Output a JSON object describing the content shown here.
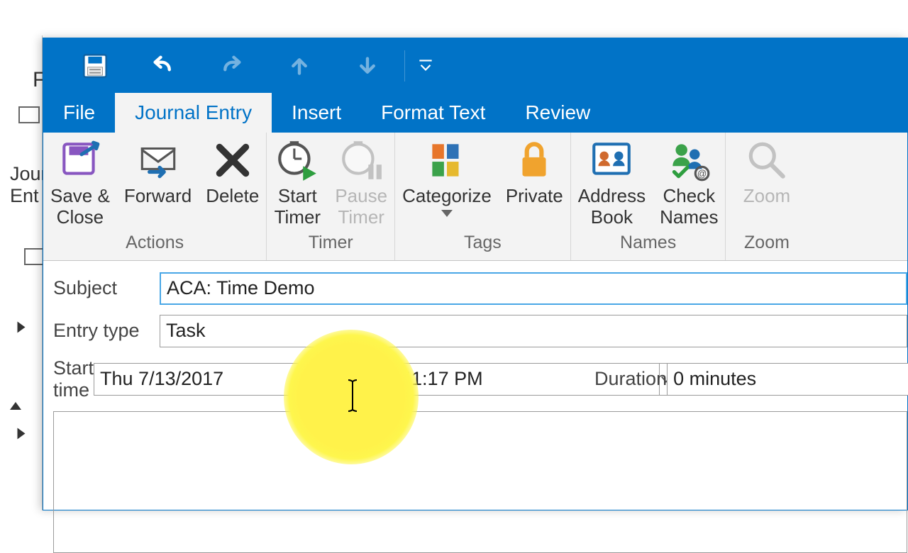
{
  "background": {
    "letter": "F",
    "side_label": "Jour\nEnt"
  },
  "qat": {
    "save": "save-icon",
    "undo": "undo-icon",
    "redo": "redo-icon",
    "up": "arrow-up-icon",
    "down": "arrow-down-icon",
    "customize": "customize-icon"
  },
  "tabs": {
    "file": "File",
    "journal_entry": "Journal Entry",
    "insert": "Insert",
    "format_text": "Format Text",
    "review": "Review"
  },
  "ribbon": {
    "actions": {
      "label": "Actions",
      "save_close": "Save &\nClose",
      "forward": "Forward",
      "delete": "Delete"
    },
    "timer": {
      "label": "Timer",
      "start": "Start\nTimer",
      "pause": "Pause\nTimer"
    },
    "tags": {
      "label": "Tags",
      "categorize": "Categorize",
      "private": "Private"
    },
    "names": {
      "label": "Names",
      "address_book": "Address\nBook",
      "check_names": "Check\nNames"
    },
    "zoom": {
      "label": "Zoom",
      "zoom": "Zoom"
    }
  },
  "form": {
    "subject_label": "Subject",
    "subject_value": "ACA: Time Demo",
    "entry_type_label": "Entry type",
    "entry_type_value": "Task",
    "start_time_label": "Start time",
    "start_date_value": "Thu 7/13/2017",
    "start_time_value": "11:17 PM",
    "duration_label": "Duration",
    "duration_value": "0 minutes"
  }
}
